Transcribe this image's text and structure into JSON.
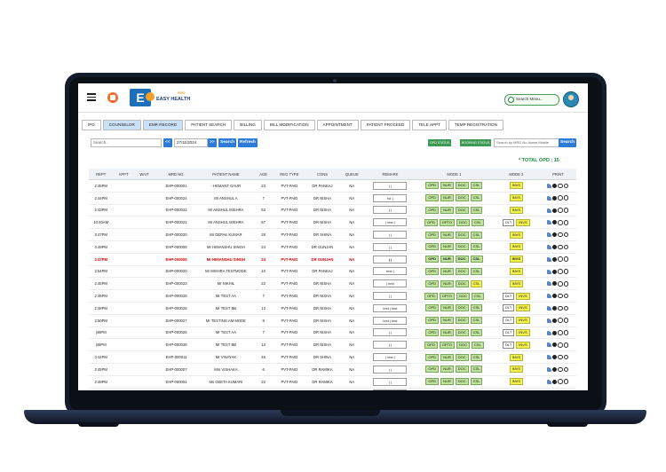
{
  "brand": {
    "logo_letter": "E",
    "name": "EASY HEALTH",
    "tag": "PRO"
  },
  "search_menu_placeholder": "Search Menu...",
  "tabs": [
    "IPD",
    "COUNSELOR",
    "EMR RECORD",
    "PATIENT SEARCH",
    "BILLING",
    "BILL MODIFICATION",
    "APPOINTMENT",
    "PATIENT PROCEED",
    "TELE APPT",
    "TEMP REGISTRATION"
  ],
  "selected_tabs": [
    "COUNSELOR",
    "EMR RECORD"
  ],
  "filters": {
    "search_placeholder": "Search..",
    "prev_label": "<<",
    "date": "27/11/2024",
    "next_label": ">>",
    "search_label": "Search",
    "refresh_label": "Refresh",
    "opd_status_label": "OPD STATUS",
    "booking_status_label": "BOOKING STATUS",
    "mrd_placeholder": "Search by MRD No,Name,Mobile",
    "search2_label": "Search"
  },
  "total_opd": "* TOTAL OPD : 15",
  "columns": [
    "REPT",
    "APPT",
    "WAIT",
    "MRD NO.",
    "PATIENT NAME",
    "AGE",
    "REG TYPE",
    "CONS",
    "QUEUE",
    "REMARK",
    "MODE 1",
    "MODE 2",
    "PRINT"
  ],
  "rows": [
    {
      "rept": "2:45PM",
      "mrd": "EHP-000001",
      "name": "- HEMANT GAUR",
      "age": "23",
      "reg": "PVT-PAID",
      "cons": "DR PANKAJ",
      "queue": "NA",
      "remark": "|  |",
      "mode1": [
        "OPD",
        "NUR",
        "DOC",
        "CSL"
      ],
      "mode1_highlight": "",
      "mode2_dlt": "",
      "mode2": "INVS",
      "red": false
    },
    {
      "rept": "2:44PM",
      "mrd": "EHP-000024",
      "name": "Mr ANSHUL A",
      "age": "7",
      "reg": "PVT-PAID",
      "cons": "DR NISHA",
      "queue": "NA",
      "remark": "tst |",
      "mode1": [
        "OPD",
        "NUR",
        "DOC",
        "CSL"
      ],
      "mode1_highlight": "",
      "mode2_dlt": "",
      "mode2": "INVS",
      "red": false
    },
    {
      "rept": "2:43PM",
      "mrd": "EHP-000022",
      "name": "Mr ANSHUL MISHRA",
      "age": "63",
      "reg": "PVT-PAID",
      "cons": "DR NISHA",
      "queue": "NA",
      "remark": "|  |",
      "mode1": [
        "OPD",
        "NUR",
        "DOC",
        "CSL"
      ],
      "mode1_highlight": "",
      "mode2_dlt": "",
      "mode2": "INVS",
      "red": false
    },
    {
      "rept": "10:40AM",
      "mrd": "EHP-000021",
      "name": "Mr ANSHUL MISHRA",
      "age": "67",
      "reg": "PVT-PAID",
      "cons": "DR NISHA",
      "queue": "NA",
      "remark": "| test |",
      "mode1": [
        "OPD",
        "OPTO",
        "DOC",
        "CSL"
      ],
      "mode1_highlight": "",
      "mode2_dlt": "DLT",
      "mode2": "INVS",
      "red": false
    },
    {
      "rept": "3:47PM",
      "mrd": "EHP-000020",
      "name": "Mr DEPAK KUMAR",
      "age": "28",
      "reg": "PVT-PAID",
      "cons": "DR SHINA",
      "queue": "NA",
      "remark": "|  |",
      "mode1": [
        "OPD",
        "NUR",
        "DOC",
        "CSL"
      ],
      "mode1_highlight": "",
      "mode2_dlt": "",
      "mode2": "INVS",
      "red": false
    },
    {
      "rept": "3:49PM",
      "mrd": "EHP-000005",
      "name": "Mr HIMANSHU SINGH",
      "age": "24",
      "reg": "PVT-PAID",
      "cons": "DR GUNJAN",
      "queue": "NA",
      "remark": "|  |",
      "mode1": [
        "OPD",
        "NUR",
        "DOC",
        "CSL"
      ],
      "mode1_highlight": "",
      "mode2_dlt": "",
      "mode2": "INVS",
      "red": false
    },
    {
      "rept": "3:47PM",
      "mrd": "EHP-000005",
      "name": "Mr HIMANSHU SINGH",
      "age": "24",
      "reg": "PVT-PAID",
      "cons": "DR GUNJAN",
      "queue": "NA",
      "remark": "|  |",
      "mode1": [
        "OPD",
        "NUR",
        "DOC",
        "CSL"
      ],
      "mode1_highlight": "",
      "mode2_dlt": "",
      "mode2": "INVS",
      "red": true
    },
    {
      "rept": "2:54PM",
      "mrd": "EHP-000020",
      "name": "Mr MISHRA TESTMODE",
      "age": "10",
      "reg": "PVT-PAID",
      "cons": "DR PANKAJ",
      "queue": "NA",
      "remark": "test |",
      "mode1": [
        "OPD",
        "NUR",
        "DOC",
        "CSL"
      ],
      "mode1_highlight": "",
      "mode2_dlt": "",
      "mode2": "INVS",
      "red": false
    },
    {
      "rept": "2:45PM",
      "mrd": "EHP-000023",
      "name": "Mr NIKHIL",
      "age": "22",
      "reg": "PVT-PAID",
      "cons": "DR NISHA",
      "queue": "NA",
      "remark": "| test",
      "mode1": [
        "OPD",
        "NUR",
        "DOC",
        "CSL"
      ],
      "mode1_highlight": "CSL",
      "mode2_dlt": "",
      "mode2": "INVS",
      "red": false
    },
    {
      "rept": "2:46PM",
      "mrd": "EHP-000025",
      "name": "Mr TEST AA",
      "age": "7",
      "reg": "PVT-PAID",
      "cons": "DR NISHA",
      "queue": "NA",
      "remark": "|  |",
      "mode1": [
        "OPD",
        "OPTO",
        "DOC",
        "CSL"
      ],
      "mode1_highlight": "",
      "mode2_dlt": "DLT",
      "mode2": "INVS",
      "red": false
    },
    {
      "rept": "2:48PM",
      "mrd": "EHP-000026",
      "name": "Mr TEST BB",
      "age": "13",
      "reg": "PVT-PAID",
      "cons": "DR NISHA",
      "queue": "NA",
      "remark": "test | test",
      "mode1": [
        "OPD",
        "NUR",
        "DOC",
        "CSL"
      ],
      "mode1_highlight": "",
      "mode2_dlt": "DLT",
      "mode2": "INVS",
      "red": false
    },
    {
      "rept": "2:50PM",
      "mrd": "EHP-000027",
      "name": "Mr TESTING AM MODE",
      "age": "9",
      "reg": "PVT-PAID",
      "cons": "DR NISHA",
      "queue": "NA",
      "remark": "test | test",
      "mode1": [
        "OPD",
        "NUR",
        "DOC",
        "CSL"
      ],
      "mode1_highlight": "",
      "mode2_dlt": "DLT",
      "mode2": "INVS",
      "red": false
    },
    {
      "rept": "|46PM",
      "mrd": "EHP-000025",
      "name": "Mr TEST AA",
      "age": "7",
      "reg": "PVT-PAID",
      "cons": "DR NISHA",
      "queue": "NA",
      "remark": "|  |",
      "mode1": [
        "OPD",
        "NUR",
        "DOC",
        "CSL"
      ],
      "mode1_highlight": "",
      "mode2_dlt": "DLT",
      "mode2": "INVS",
      "red": false
    },
    {
      "rept": "|48PM",
      "mrd": "EHP-000026",
      "name": "Mr TEST BB",
      "age": "13",
      "reg": "PVT-PAID",
      "cons": "DR NISHA",
      "queue": "NA",
      "remark": "|  |",
      "mode1": [
        "OPD",
        "OPTO",
        "DOC",
        "CSL"
      ],
      "mode1_highlight": "",
      "mode2_dlt": "DLT",
      "mode2": "INVS",
      "red": false
    },
    {
      "rept": "3:44PM",
      "mrd": "EHP-000011",
      "name": "Mr VINAYAK",
      "age": "45",
      "reg": "PVT-PAID",
      "cons": "DR SHINA",
      "queue": "NA",
      "remark": "| test |",
      "mode1": [
        "OPD",
        "NUR",
        "DOC",
        "CSL"
      ],
      "mode1_highlight": "",
      "mode2_dlt": "",
      "mode2": "INVS",
      "red": false
    },
    {
      "rept": "2:45PM",
      "mrd": "EHP-000007",
      "name": "Mrs VISHAKA",
      "age": "6",
      "reg": "PVT-PAID",
      "cons": "DR RAMIKA",
      "queue": "NA",
      "remark": "|  |",
      "mode1": [
        "OPD",
        "NUR",
        "DOC",
        "CSL"
      ],
      "mode1_highlight": "",
      "mode2_dlt": "",
      "mode2": "INVS",
      "red": false
    },
    {
      "rept": "2:49PM",
      "mrd": "EHP-000004",
      "name": "Ms GEETA KUMARI",
      "age": "22",
      "reg": "PVT-PAID",
      "cons": "DR RAMIKA",
      "queue": "NA",
      "remark": "|  |",
      "mode1": [
        "OPD",
        "NUR",
        "DOC",
        "CSL"
      ],
      "mode1_highlight": "",
      "mode2_dlt": "",
      "mode2": "INVS",
      "red": false
    },
    {
      "rept": "3:44PM",
      "mrd": "EHP-000002",
      "name": "Ms POOJA MAURYA",
      "age": "29",
      "reg": "PVT-PAID",
      "cons": "DR GUNJAN",
      "queue": "NA",
      "remark": "|  |",
      "mode1": [
        "OPD",
        "NUR",
        "DOC",
        "CSL"
      ],
      "mode1_highlight": "",
      "mode2_dlt": "",
      "mode2": "INVS",
      "red": false
    }
  ],
  "colors": {
    "header_bg": "#eef1f5",
    "mode_green": "#bfe39a",
    "mode_yellow": "#f2f24e",
    "total_green": "#1e8a3e",
    "accent_blue": "#2c7bd6"
  }
}
